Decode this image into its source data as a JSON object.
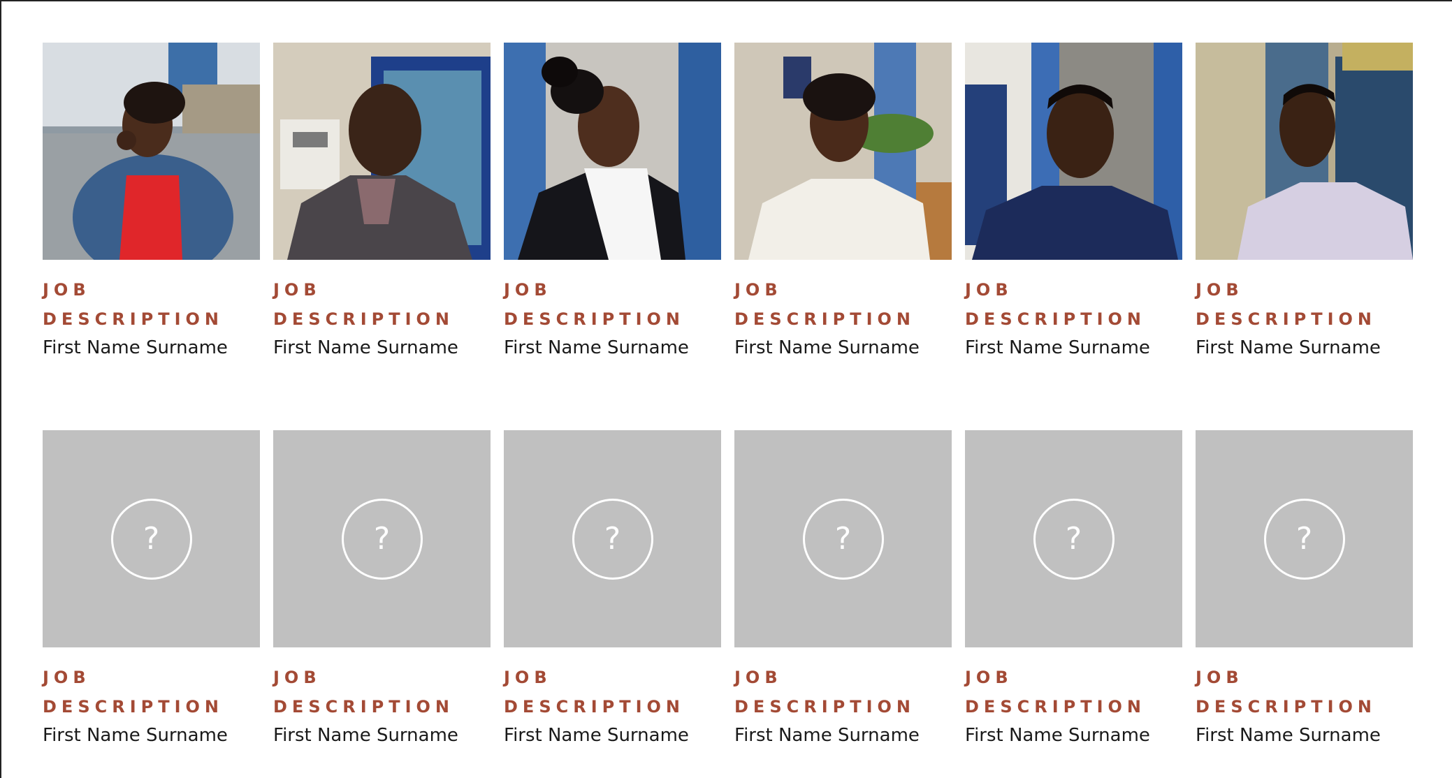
{
  "colors": {
    "job_text": "#a34a35",
    "name_text": "#1a1a1a",
    "placeholder_bg": "#c0c0c0",
    "placeholder_icon": "#ffffff"
  },
  "placeholder": {
    "icon": "question-mark-icon",
    "glyph": "?"
  },
  "team": {
    "row1": [
      {
        "job_line1": "JOB",
        "job_line2": "DESCRIPTION",
        "name": "First Name Surname"
      },
      {
        "job_line1": "JOB",
        "job_line2": "DESCRIPTION",
        "name": "First Name Surname"
      },
      {
        "job_line1": "JOB",
        "job_line2": "DESCRIPTION",
        "name": "First Name Surname"
      },
      {
        "job_line1": "JOB",
        "job_line2": "DESCRIPTION",
        "name": "First Name Surname"
      },
      {
        "job_line1": "JOB",
        "job_line2": "DESCRIPTION",
        "name": "First Name Surname"
      },
      {
        "job_line1": "JOB",
        "job_line2": "DESCRIPTION",
        "name": "First Name Surname"
      }
    ],
    "row2": [
      {
        "job_line1": "JOB",
        "job_line2": "DESCRIPTION",
        "name": "First Name Surname"
      },
      {
        "job_line1": "JOB",
        "job_line2": "DESCRIPTION",
        "name": "First Name Surname"
      },
      {
        "job_line1": "JOB",
        "job_line2": "DESCRIPTION",
        "name": "First Name Surname"
      },
      {
        "job_line1": "JOB",
        "job_line2": "DESCRIPTION",
        "name": "First Name Surname"
      },
      {
        "job_line1": "JOB",
        "job_line2": "DESCRIPTION",
        "name": "First Name Surname"
      },
      {
        "job_line1": "JOB",
        "job_line2": "DESCRIPTION",
        "name": "First Name Surname"
      }
    ]
  }
}
